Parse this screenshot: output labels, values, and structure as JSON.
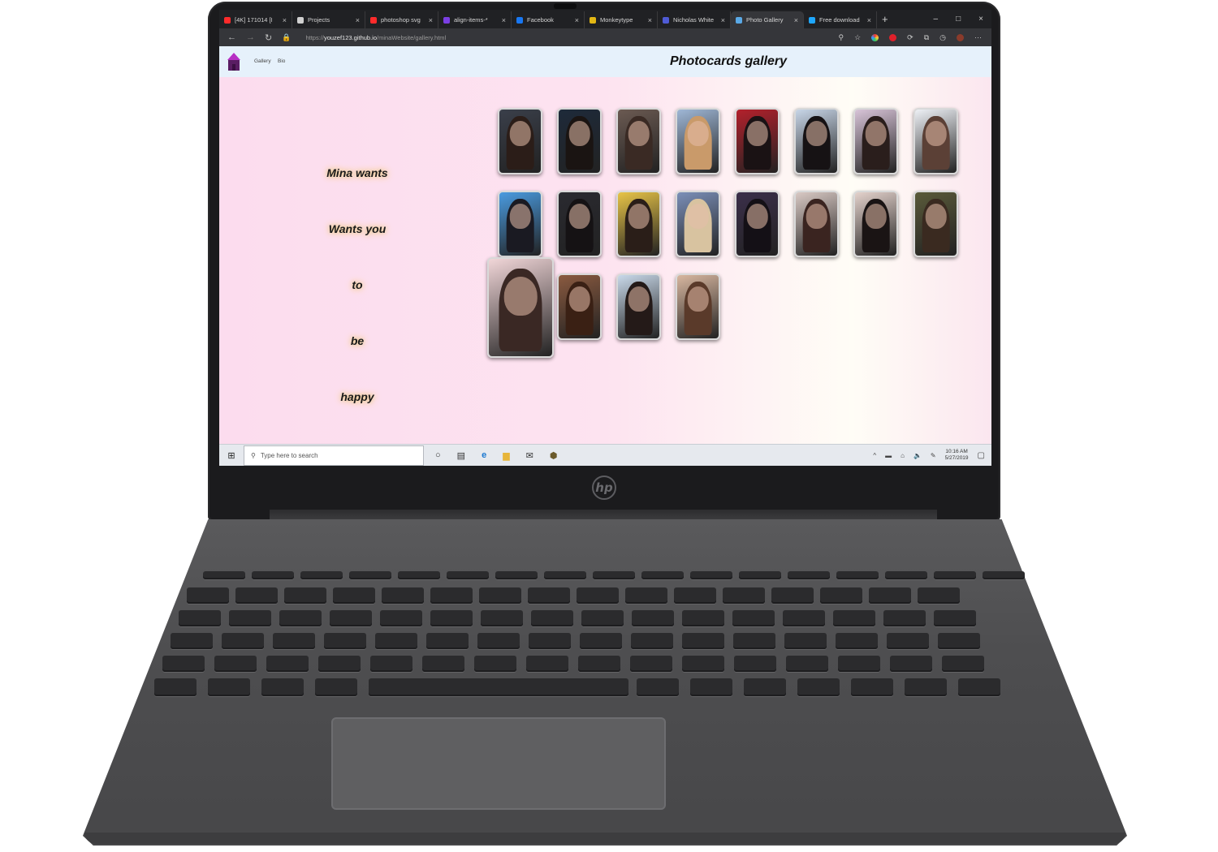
{
  "browser": {
    "tabs": [
      {
        "label": "[4K] 171014 [I",
        "favicon_color": "#ff2b2b",
        "active": false
      },
      {
        "label": "Projects",
        "favicon_color": "#d0d0d0",
        "active": false
      },
      {
        "label": "photoshop svg",
        "favicon_color": "#ff2b2b",
        "active": false
      },
      {
        "label": "align-items-*",
        "favicon_color": "#7b3fe4",
        "active": false
      },
      {
        "label": "Facebook",
        "favicon_color": "#1877f2",
        "active": false
      },
      {
        "label": "Monkeytype",
        "favicon_color": "#e2b714",
        "active": false
      },
      {
        "label": "Nicholas White",
        "favicon_color": "#4f5bd5",
        "active": false
      },
      {
        "label": "Photo Gallery",
        "favicon_color": "#5aa9e6",
        "active": true
      },
      {
        "label": "Free download",
        "favicon_color": "#1ea7fd",
        "active": false
      }
    ],
    "new_tab_glyph": "+",
    "close_glyph": "×",
    "window_controls": [
      "–",
      "□",
      "×"
    ],
    "url_prefix": "https://",
    "url_host": "youzef123.github.io",
    "url_path": "/minaWebsite/gallery.html"
  },
  "site": {
    "nav": {
      "gallery": "Gallery",
      "bio": "Bio"
    },
    "title": "Photocards gallery",
    "side_lines": [
      "Mina wants",
      "Wants you",
      "to",
      "be",
      "happy"
    ],
    "cards": [
      {
        "bg": "#3a3f4a",
        "hair": "#2b1d18"
      },
      {
        "bg": "#1e2a3a",
        "hair": "#1a1412"
      },
      {
        "bg": "#6b5a52",
        "hair": "#3a2a24"
      },
      {
        "bg": "#9fb7d6",
        "hair": "#c99a6a"
      },
      {
        "bg": "#b3212c",
        "hair": "#1a1214"
      },
      {
        "bg": "#c8d6e8",
        "hair": "#161214"
      },
      {
        "bg": "#d8c4d8",
        "hair": "#2a1e1c"
      },
      {
        "bg": "#eef1f6",
        "hair": "#5b4036"
      },
      {
        "bg": "#4a9be0",
        "hair": "#1a1a22"
      },
      {
        "bg": "#2a2a30",
        "hair": "#151214"
      },
      {
        "bg": "#e8c447",
        "hair": "#2a1e18"
      },
      {
        "bg": "#7b8fb8",
        "hair": "#d8c3a0"
      },
      {
        "bg": "#3b2f4a",
        "hair": "#141016"
      },
      {
        "bg": "#d9c9c4",
        "hair": "#3a2420"
      },
      {
        "bg": "#e4d2cc",
        "hair": "#1a1414"
      },
      {
        "bg": "#5a5a3a",
        "hair": "#3a2a20"
      },
      {
        "bg": "#f1d6d8",
        "hair": "#3a2824"
      },
      {
        "bg": "#8a5a40",
        "hair": "#3a2014"
      },
      {
        "bg": "#c9d9ea",
        "hair": "#241a18"
      },
      {
        "bg": "#d8b7a0",
        "hair": "#5a3a2a"
      }
    ]
  },
  "taskbar": {
    "start_glyph": "⊞",
    "search_placeholder": "Type here to search",
    "search_glyph": "⚲",
    "app_glyphs": [
      "○",
      "▤",
      "e",
      "▆",
      "✉",
      "⬢"
    ],
    "tray_glyphs": [
      "^",
      "▬",
      "⌂",
      "🔈",
      "✎"
    ],
    "time": "10:16 AM",
    "date": "5/27/2019",
    "notify_glyph": "▢"
  },
  "laptop": {
    "brand": "hp"
  }
}
